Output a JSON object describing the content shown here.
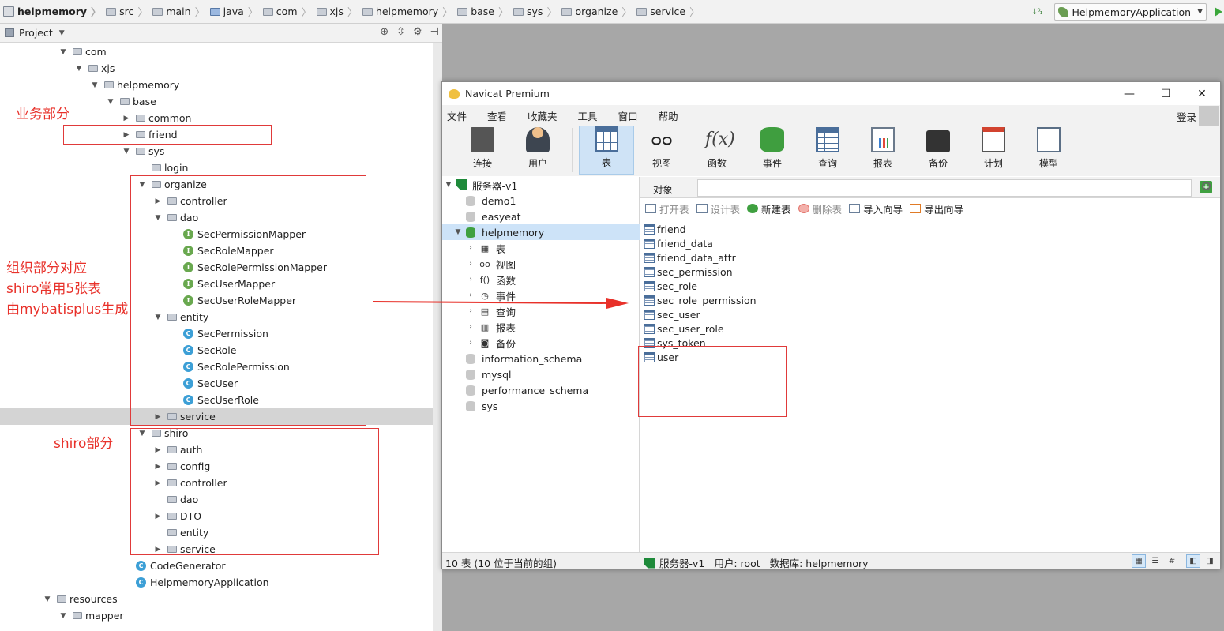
{
  "breadcrumb": [
    "helpmemory",
    "src",
    "main",
    "java",
    "com",
    "xjs",
    "helpmemory",
    "base",
    "sys",
    "organize",
    "service"
  ],
  "run_config": "HelpmemoryApplication",
  "project_panel": {
    "title": "Project"
  },
  "tree": [
    {
      "label": "com",
      "kind": "folder",
      "arrow": "down",
      "indent": 0
    },
    {
      "label": "xjs",
      "kind": "folder",
      "arrow": "down",
      "indent": 1
    },
    {
      "label": "helpmemory",
      "kind": "folder",
      "arrow": "down",
      "indent": 2
    },
    {
      "label": "base",
      "kind": "folder",
      "arrow": "down",
      "indent": 3
    },
    {
      "label": "common",
      "kind": "folder",
      "arrow": "right",
      "indent": 4
    },
    {
      "label": "friend",
      "kind": "folder",
      "arrow": "right",
      "indent": 4
    },
    {
      "label": "sys",
      "kind": "folder",
      "arrow": "down",
      "indent": 4
    },
    {
      "label": "login",
      "kind": "folder",
      "arrow": "none",
      "indent": 5
    },
    {
      "label": "organize",
      "kind": "folder",
      "arrow": "down",
      "indent": 5
    },
    {
      "label": "controller",
      "kind": "folder",
      "arrow": "right",
      "indent": 6
    },
    {
      "label": "dao",
      "kind": "folder",
      "arrow": "down",
      "indent": 6
    },
    {
      "label": "SecPermissionMapper",
      "kind": "interface",
      "arrow": "none",
      "indent": 7
    },
    {
      "label": "SecRoleMapper",
      "kind": "interface",
      "arrow": "none",
      "indent": 7
    },
    {
      "label": "SecRolePermissionMapper",
      "kind": "interface",
      "arrow": "none",
      "indent": 7
    },
    {
      "label": "SecUserMapper",
      "kind": "interface",
      "arrow": "none",
      "indent": 7
    },
    {
      "label": "SecUserRoleMapper",
      "kind": "interface",
      "arrow": "none",
      "indent": 7
    },
    {
      "label": "entity",
      "kind": "folder",
      "arrow": "down",
      "indent": 6
    },
    {
      "label": "SecPermission",
      "kind": "class",
      "arrow": "none",
      "indent": 7
    },
    {
      "label": "SecRole",
      "kind": "class",
      "arrow": "none",
      "indent": 7
    },
    {
      "label": "SecRolePermission",
      "kind": "class",
      "arrow": "none",
      "indent": 7
    },
    {
      "label": "SecUser",
      "kind": "class",
      "arrow": "none",
      "indent": 7
    },
    {
      "label": "SecUserRole",
      "kind": "class",
      "arrow": "none",
      "indent": 7
    },
    {
      "label": "service",
      "kind": "folder",
      "arrow": "right",
      "indent": 6,
      "selected": true
    },
    {
      "label": "shiro",
      "kind": "folder",
      "arrow": "down",
      "indent": 5
    },
    {
      "label": "auth",
      "kind": "folder",
      "arrow": "right",
      "indent": 6
    },
    {
      "label": "config",
      "kind": "folder",
      "arrow": "right",
      "indent": 6
    },
    {
      "label": "controller",
      "kind": "folder",
      "arrow": "right",
      "indent": 6
    },
    {
      "label": "dao",
      "kind": "folder",
      "arrow": "none",
      "indent": 6
    },
    {
      "label": "DTO",
      "kind": "folder",
      "arrow": "right",
      "indent": 6
    },
    {
      "label": "entity",
      "kind": "folder",
      "arrow": "none",
      "indent": 6
    },
    {
      "label": "service",
      "kind": "folder",
      "arrow": "right",
      "indent": 6
    },
    {
      "label": "CodeGenerator",
      "kind": "class",
      "arrow": "none",
      "indent": 4
    },
    {
      "label": "HelpmemoryApplication",
      "kind": "class",
      "arrow": "none",
      "indent": 4
    },
    {
      "label": "resources",
      "kind": "folder",
      "arrow": "down",
      "indent": -1
    },
    {
      "label": "mapper",
      "kind": "folder",
      "arrow": "down",
      "indent": 0
    }
  ],
  "annotations": {
    "business": "业务部分",
    "org_line1": "组织部分对应",
    "org_line2": "shiro常用5张表",
    "org_line3": "由mybatisplus生成",
    "shiro": "shiro部分"
  },
  "navicat": {
    "title": "Navicat Premium",
    "menu": [
      "文件",
      "查看",
      "收藏夹",
      "工具",
      "窗口",
      "帮助"
    ],
    "login": "登录",
    "toolbar": [
      {
        "label": "连接",
        "icon": "plug-icon"
      },
      {
        "label": "用户",
        "icon": "user-icon"
      },
      {
        "label": "表",
        "icon": "table-icon",
        "active": true
      },
      {
        "label": "视图",
        "icon": "view-icon"
      },
      {
        "label": "函数",
        "icon": "function-icon"
      },
      {
        "label": "事件",
        "icon": "event-icon"
      },
      {
        "label": "查询",
        "icon": "query-icon"
      },
      {
        "label": "报表",
        "icon": "report-icon"
      },
      {
        "label": "备份",
        "icon": "backup-icon"
      },
      {
        "label": "计划",
        "icon": "schedule-icon"
      },
      {
        "label": "模型",
        "icon": "model-icon"
      }
    ],
    "connections": [
      {
        "label": "服务器-v1",
        "type": "server",
        "arrow": "down"
      },
      {
        "label": "demo1",
        "type": "db"
      },
      {
        "label": "easyeat",
        "type": "db"
      },
      {
        "label": "helpmemory",
        "type": "db-open",
        "arrow": "down",
        "selected": true
      },
      {
        "label": "表",
        "type": "sub",
        "icon": "▦",
        "arrow": "right"
      },
      {
        "label": "视图",
        "type": "sub",
        "icon": "oo",
        "arrow": "right"
      },
      {
        "label": "函数",
        "type": "sub",
        "icon": "f()",
        "arrow": "right"
      },
      {
        "label": "事件",
        "type": "sub",
        "icon": "◷",
        "arrow": "right"
      },
      {
        "label": "查询",
        "type": "sub",
        "icon": "▤",
        "arrow": "right"
      },
      {
        "label": "报表",
        "type": "sub",
        "icon": "▥",
        "arrow": "right"
      },
      {
        "label": "备份",
        "type": "sub",
        "icon": "◙",
        "arrow": "right"
      },
      {
        "label": "information_schema",
        "type": "db"
      },
      {
        "label": "mysql",
        "type": "db"
      },
      {
        "label": "performance_schema",
        "type": "db"
      },
      {
        "label": "sys",
        "type": "db"
      }
    ],
    "object_tab": "对象",
    "object_tools": [
      {
        "label": "打开表",
        "enabled": false
      },
      {
        "label": "设计表",
        "enabled": false
      },
      {
        "label": "新建表",
        "enabled": true
      },
      {
        "label": "删除表",
        "enabled": false
      },
      {
        "label": "导入向导",
        "enabled": true
      },
      {
        "label": "导出向导",
        "enabled": true
      }
    ],
    "tables": [
      "friend",
      "friend_data",
      "friend_data_attr",
      "sec_permission",
      "sec_role",
      "sec_role_permission",
      "sec_user",
      "sec_user_role",
      "sys_token",
      "user"
    ],
    "status_left": "10 表 (10 位于当前的组)",
    "status_server": "服务器-v1",
    "status_user": "用户: root",
    "status_db": "数据库: helpmemory"
  }
}
